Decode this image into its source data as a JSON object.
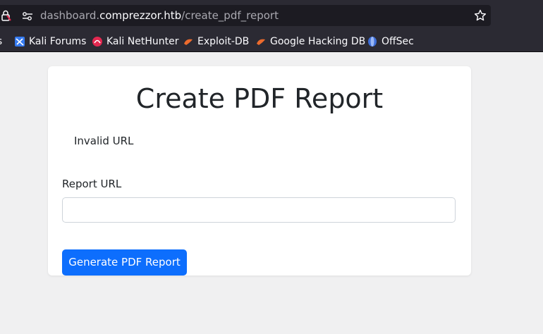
{
  "browser": {
    "url_scheme_hidden": "",
    "url_subdomain": "dashboard.",
    "url_host": "comprezzor.htb",
    "url_path": "/create_pdf_report"
  },
  "bookmarks": [
    {
      "label": "ls",
      "icon": "kali-icon"
    },
    {
      "label": "Kali Forums",
      "icon": "kali-forums-icon"
    },
    {
      "label": "Kali NetHunter",
      "icon": "nethunter-icon"
    },
    {
      "label": "Exploit-DB",
      "icon": "exploit-db-icon"
    },
    {
      "label": "Google Hacking DB",
      "icon": "ghdb-icon"
    },
    {
      "label": "OffSec",
      "icon": "offsec-icon"
    }
  ],
  "card": {
    "title": "Create PDF Report",
    "alert": "Invalid URL",
    "field_label": "Report URL",
    "field_value": "",
    "field_placeholder": "",
    "submit_label": "Generate PDF Report"
  },
  "colors": {
    "primary": "#0d6efd",
    "page_bg": "#f0f0f1",
    "toolbar_bg": "#2b2a33"
  }
}
